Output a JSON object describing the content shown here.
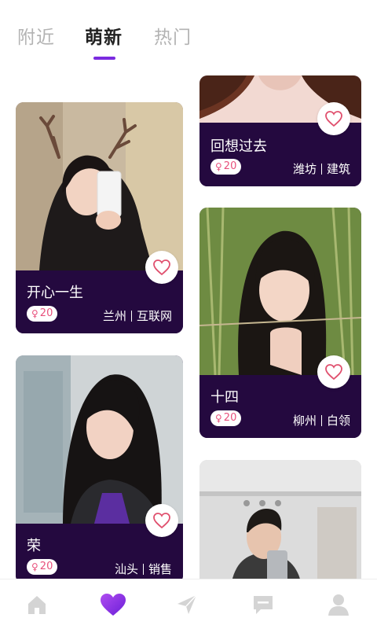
{
  "tabs": [
    {
      "label": "附近",
      "active": false
    },
    {
      "label": "萌新",
      "active": true
    },
    {
      "label": "热门",
      "active": false
    }
  ],
  "cards": [
    {
      "name": "回想过去",
      "age": "20",
      "city": "潍坊",
      "job": "建筑"
    },
    {
      "name": "开心一生",
      "age": "20",
      "city": "兰州",
      "job": "互联网"
    },
    {
      "name": "十四",
      "age": "20",
      "city": "柳州",
      "job": "白领"
    },
    {
      "name": "荣",
      "age": "20",
      "city": "汕头",
      "job": "销售"
    },
    {
      "name": "",
      "age": "",
      "city": "",
      "job": ""
    }
  ],
  "icons": {
    "female": "♀",
    "like": "heart-outline-icon",
    "nav": [
      "home-icon",
      "heart-icon",
      "send-icon",
      "message-icon",
      "profile-icon"
    ]
  },
  "colors": {
    "accent": "#7b2be0",
    "card_info_bg": "#24093f",
    "badge_text": "#e8507c",
    "heart_stroke": "#e0506e",
    "nav_inactive": "#d4d4d4"
  }
}
